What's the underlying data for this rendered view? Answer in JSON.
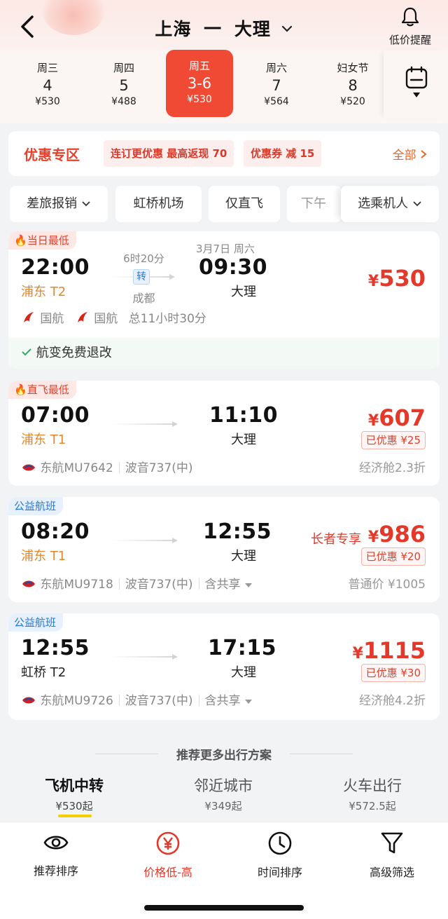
{
  "header": {
    "from": "上海",
    "arrow": "一",
    "to": "大理",
    "alert_label": "低价提醒"
  },
  "dates": [
    {
      "weekday": "周三",
      "day": "4",
      "price": "¥530",
      "selected": false
    },
    {
      "weekday": "周四",
      "day": "5",
      "price": "¥488",
      "selected": false
    },
    {
      "weekday": "周五",
      "day": "3-6",
      "price": "¥530",
      "selected": true
    },
    {
      "weekday": "周六",
      "day": "7",
      "price": "¥564",
      "selected": false
    },
    {
      "weekday": "妇女节",
      "day": "8",
      "price": "¥520",
      "selected": false
    }
  ],
  "promo": {
    "title": "优惠专区",
    "tag1": "连订更优惠 最高返现 70",
    "tag2": "优惠券 减 15",
    "all": "全部"
  },
  "filters": [
    "差旅报销",
    "虹桥机场",
    "仅直飞",
    "下午",
    "选乘机人"
  ],
  "flights": [
    {
      "badge": "当日最低",
      "dep_time": "22:00",
      "dep_apt": "浦东 T2",
      "duration": "6时20分",
      "transfer": "转",
      "via": "成都",
      "arr_date": "3月7日 周六",
      "arr_time": "09:30",
      "arr_city": "大理",
      "price": "530",
      "airline1": "国航",
      "airline2": "国航",
      "total": "总11小时30分",
      "note": "航变免费退改"
    },
    {
      "badge": "直飞最低",
      "dep_time": "07:00",
      "dep_apt": "浦东 T1",
      "arr_time": "11:10",
      "arr_city": "大理",
      "price": "607",
      "discount": "已优惠 ¥25",
      "airline": "东航MU7642",
      "plane": "波音737(中)",
      "cabin": "经济舱2.3折"
    },
    {
      "badge": "公益航班",
      "dep_time": "08:20",
      "dep_apt": "浦东 T1",
      "arr_time": "12:55",
      "arr_city": "大理",
      "price_label": "长者专享",
      "price": "986",
      "discount": "已优惠 ¥20",
      "airline": "东航MU9718",
      "plane": "波音737(中)",
      "share": "含共享",
      "cabin": "普通价 ¥1005"
    },
    {
      "badge": "公益航班",
      "dep_time": "12:55",
      "dep_apt": "虹桥 T2",
      "arr_time": "17:15",
      "arr_city": "大理",
      "price": "1115",
      "discount": "已优惠 ¥30",
      "airline": "东航MU9726",
      "plane": "波音737(中)",
      "share": "含共享",
      "cabin": "经济舱4.2折"
    }
  ],
  "currency": "¥",
  "recommend": {
    "title": "推荐更多出行方案",
    "options": [
      {
        "name": "飞机中转",
        "price": "¥530起"
      },
      {
        "name": "邻近城市",
        "price": "¥349起"
      },
      {
        "name": "火车出行",
        "price": "¥572.5起"
      }
    ]
  },
  "bottom": [
    "推荐排序",
    "价格低-高",
    "时间排序",
    "高级筛选"
  ],
  "colors": {
    "accent": "#e3382a",
    "orange": "#e5872a",
    "blue": "#2777d9"
  }
}
